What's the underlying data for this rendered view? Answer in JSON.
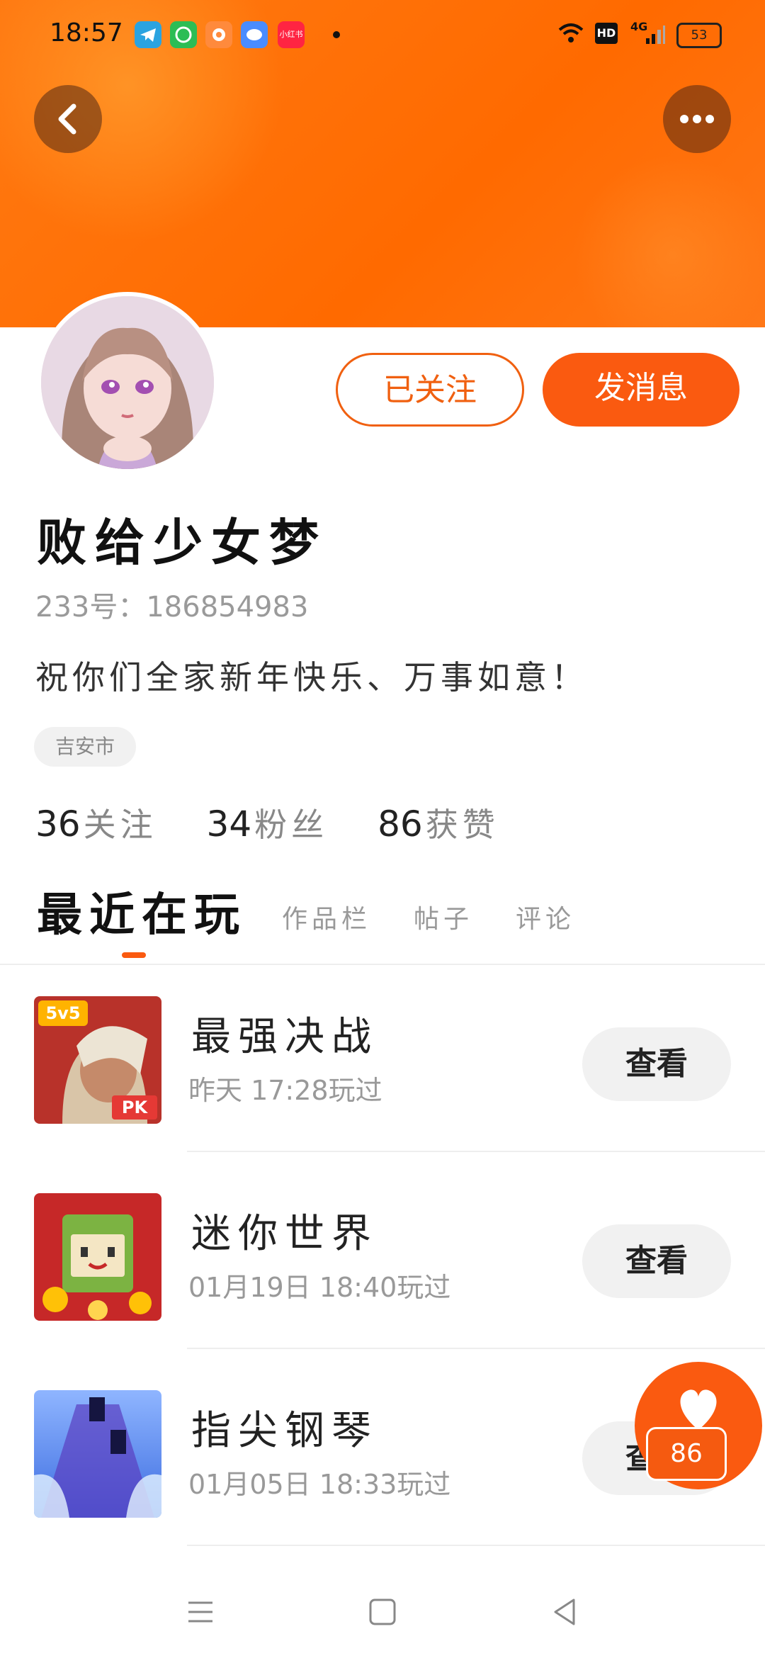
{
  "status_bar": {
    "time": "18:57",
    "apps": [
      {
        "icon": "telegram-icon",
        "color": "#2aa3e0"
      },
      {
        "icon": "wechat-mini-icon",
        "color": "#2cbd55"
      },
      {
        "icon": "app-icon",
        "color": "#ff8a3c"
      },
      {
        "icon": "chat-icon",
        "color": "#4a8cff"
      },
      {
        "icon": "xiaohongshu-icon",
        "color": "#ff2442",
        "label": "小红书"
      }
    ],
    "network": "4G",
    "hd_label": "HD",
    "battery": "53"
  },
  "profile": {
    "follow_button": "已关注",
    "message_button": "发消息",
    "username": "败给少女梦",
    "user_id": "233号：186854983",
    "bio": "祝你们全家新年快乐、万事如意！",
    "location": "吉安市",
    "stats": [
      {
        "value": "36",
        "label": "关注"
      },
      {
        "value": "34",
        "label": "粉丝"
      },
      {
        "value": "86",
        "label": "获赞"
      }
    ]
  },
  "tabs": [
    "最近在玩",
    "作品栏",
    "帖子",
    "评论"
  ],
  "games": [
    {
      "name": "最强决战",
      "played": "昨天 17:28玩过",
      "view_label": "查看",
      "icon_badge": "5v5",
      "icon_tag": "PK"
    },
    {
      "name": "迷你世界",
      "played": "01月19日 18:40玩过",
      "view_label": "查看"
    },
    {
      "name": "指尖钢琴",
      "played": "01月05日 18:33玩过",
      "view_label": "查看"
    }
  ],
  "like_fab": {
    "count": "86"
  },
  "colors": {
    "accent": "#fa5a10",
    "banner": "#ff6a00"
  }
}
